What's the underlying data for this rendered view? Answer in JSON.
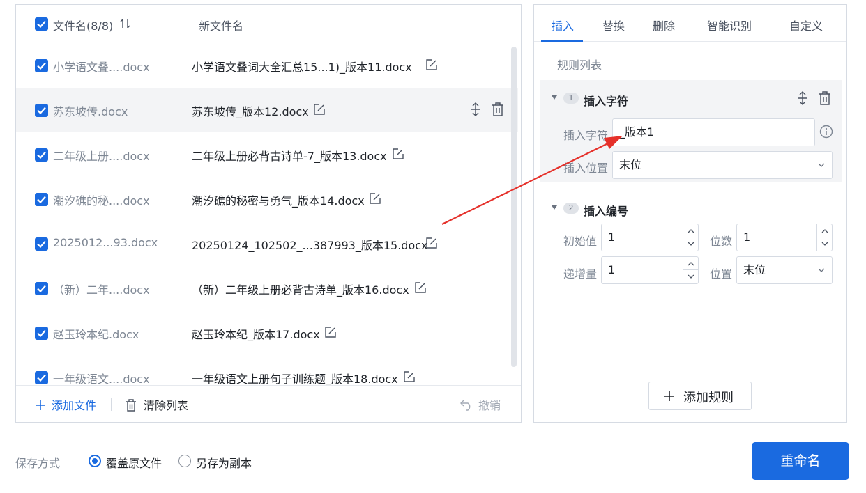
{
  "file_list": {
    "header_filename": "文件名(8/8)",
    "header_new_filename": "新文件名",
    "rows": [
      {
        "old": "小学语文叠....docx",
        "new": "小学语文叠词大全汇总15...1)_版本11.docx"
      },
      {
        "old": "苏东坡传.docx",
        "new": "苏东坡传_版本12.docx"
      },
      {
        "old": "二年级上册....docx",
        "new": "二年级上册必背古诗单-7_版本13.docx"
      },
      {
        "old": "潮汐礁的秘....docx",
        "new": "潮汐礁的秘密与勇气_版本14.docx"
      },
      {
        "old": "2025012...93.docx",
        "new": "20250124_102502_...387993_版本15.docx"
      },
      {
        "old": "（新）二年....docx",
        "new": "（新）二年级上册必背古诗单_版本16.docx"
      },
      {
        "old": "赵玉玲本纪.docx",
        "new": "赵玉玲本纪_版本17.docx"
      },
      {
        "old": "一年级语文....docx",
        "new": "一年级语文上册句子训练题_版本18.docx"
      }
    ],
    "footer": {
      "add_file": "添加文件",
      "clear_list": "清除列表",
      "undo": "撤销"
    }
  },
  "rules_panel": {
    "tabs": [
      "插入",
      "替换",
      "删除",
      "智能识别",
      "自定义"
    ],
    "active_tab": "插入",
    "list_title": "规则列表",
    "rule1": {
      "index": "1",
      "name": "插入字符",
      "char_label": "插入字符",
      "char_value": "_版本1",
      "position_label": "插入位置",
      "position_value": "末位"
    },
    "rule2": {
      "index": "2",
      "name": "插入编号",
      "start_label": "初始值",
      "start_value": "1",
      "digits_label": "位数",
      "digits_value": "1",
      "step_label": "递增量",
      "step_value": "1",
      "position_label": "位置",
      "position_value": "末位"
    },
    "add_rule": "添加规则"
  },
  "save_mode": {
    "label": "保存方式",
    "options": [
      "覆盖原文件",
      "另存为副本"
    ],
    "selected": "覆盖原文件"
  },
  "rename_button": "重命名",
  "colors": {
    "accent": "#1a6ae0",
    "arrow": "#e5302a"
  }
}
